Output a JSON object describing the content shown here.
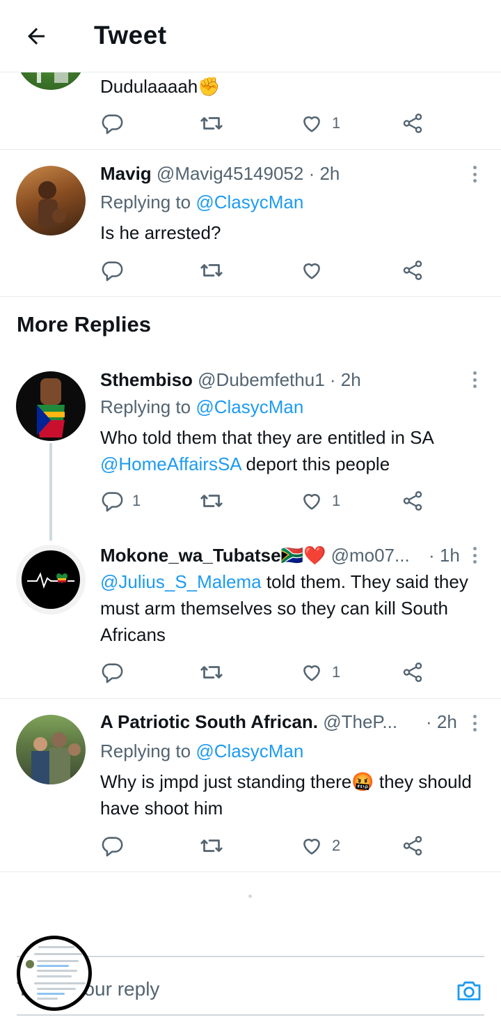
{
  "header": {
    "title": "Tweet"
  },
  "tweets": [
    {
      "body": "Dudulaaaah✊",
      "reply_count": "",
      "like_count": "1"
    },
    {
      "name": "Mavig",
      "handle": "@Mavig45149052",
      "time": "· 2h",
      "replying_prefix": "Replying to ",
      "replying_to": "@ClasycMan",
      "body": "Is he arrested?",
      "reply_count": "",
      "like_count": ""
    }
  ],
  "more_replies": {
    "title": "More Replies",
    "items": [
      {
        "name": "Sthembiso",
        "handle": "@Dubemfethu1",
        "time": "· 2h",
        "replying_prefix": "Replying to ",
        "replying_to": "@ClasycMan",
        "body_line1": "Who told them that they are entitled in SA",
        "body_mention": "@HomeAffairsSA",
        "body_rest": " deport this people",
        "reply_count": "1",
        "like_count": "1"
      },
      {
        "name": "Mokone_wa_Tubatse🇿🇦❤️",
        "handle": "@mo07...",
        "time": "· 1h",
        "body_mention": "@Julius_S_Malema",
        "body_rest": " told them. They said they must arm themselves so they can kill South Africans",
        "reply_count": "",
        "like_count": "1"
      },
      {
        "name": "A Patriotic South African.",
        "handle": "@TheP...",
        "time": "· 2h",
        "replying_prefix": "Replying to ",
        "replying_to": "@ClasycMan",
        "body": "Why is jmpd just standing there🤬 they should have shoot him",
        "reply_count": "",
        "like_count": "2"
      }
    ]
  },
  "compose": {
    "placeholder": "Tweet your reply"
  },
  "colors": {
    "accent": "#1d9bf0",
    "secondary_text": "#536471",
    "divider": "#e6ecf0"
  }
}
